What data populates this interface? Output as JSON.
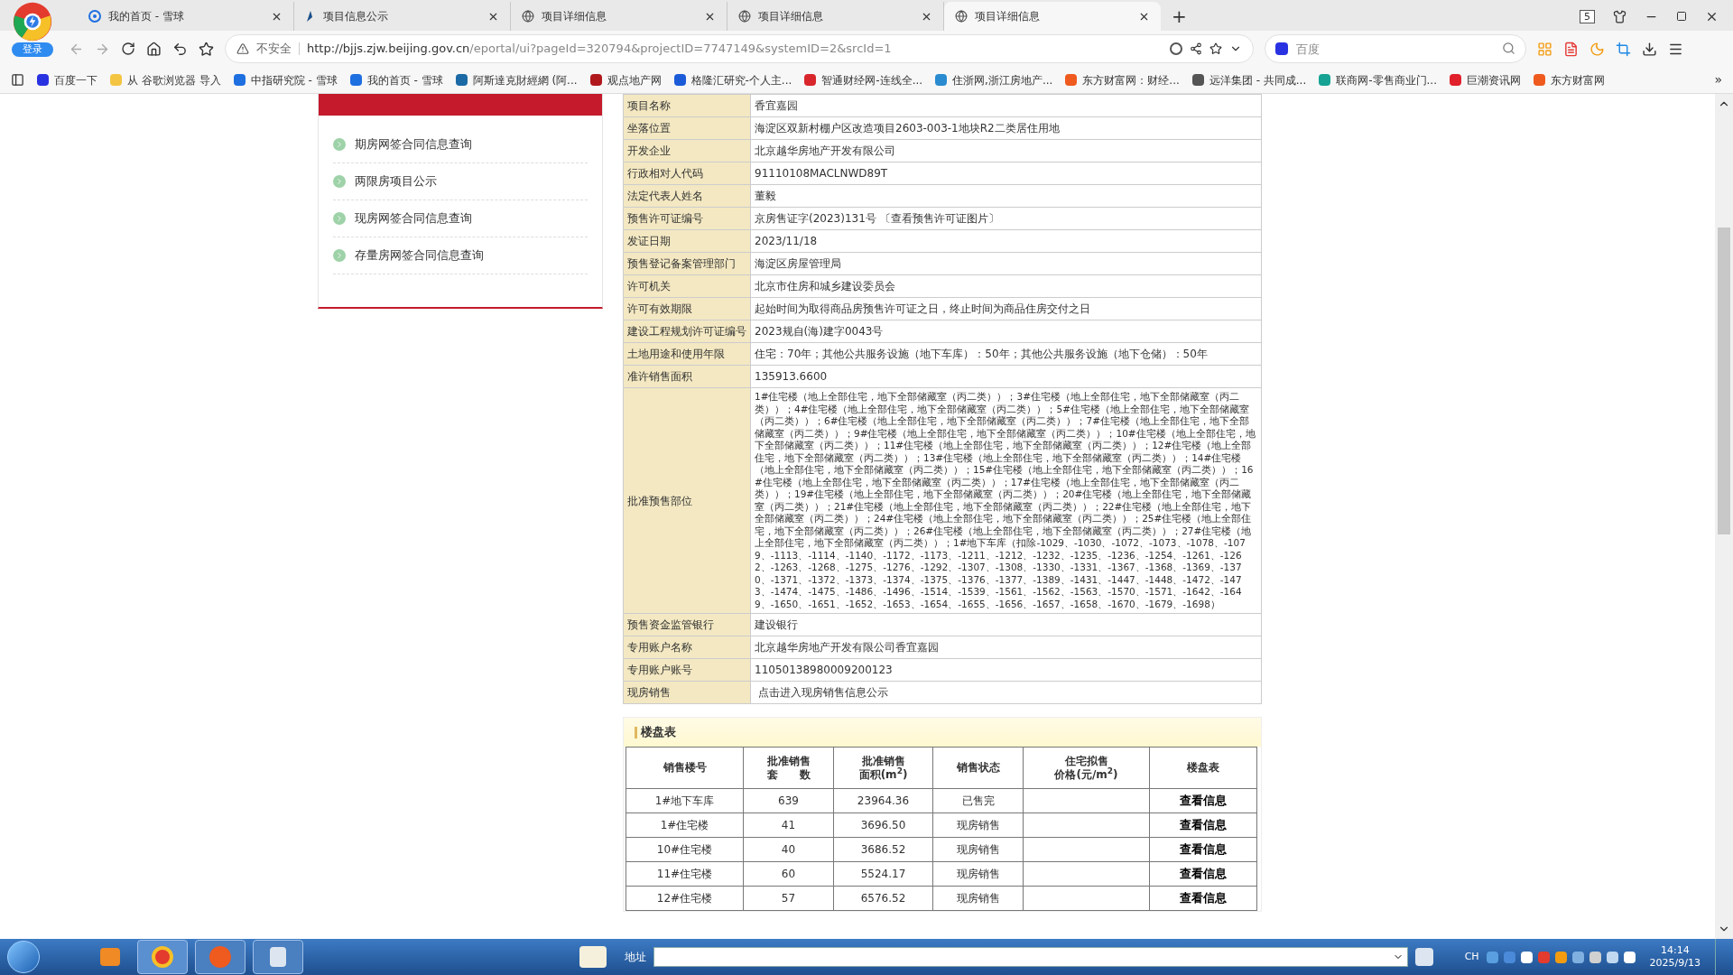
{
  "browser": {
    "login": "登录",
    "tabs": [
      {
        "title": "我的首页 - 雪球",
        "kind": "swirl",
        "selected": false
      },
      {
        "title": "项目信息公示",
        "kind": "feather",
        "selected": false
      },
      {
        "title": "项目详细信息",
        "kind": "globe",
        "selected": false
      },
      {
        "title": "项目详细信息",
        "kind": "globe",
        "selected": false
      },
      {
        "title": "项目详细信息",
        "kind": "globe",
        "selected": true
      }
    ],
    "new_tab": "+",
    "tab_count": "5",
    "address": {
      "security": "不安全",
      "url_host": "http://bjjs.zjw.beijing.gov.cn",
      "url_path": "/eportal/ui?pageId=320794&projectID=7747149&systemID=2&srcId=1"
    },
    "search": {
      "placeholder": "百度"
    },
    "bookmarks": [
      {
        "title": "百度一下",
        "color": "#2932e1"
      },
      {
        "title": "从 谷歌浏览器 导入",
        "color": "#f4c542"
      },
      {
        "title": "中指研究院 - 雪球",
        "color": "#1e6fe0"
      },
      {
        "title": "我的首页 - 雪球",
        "color": "#1e6fe0"
      },
      {
        "title": "阿斯達克財經網 (阿...",
        "color": "#1b6aa5"
      },
      {
        "title": "观点地产网",
        "color": "#b0181c"
      },
      {
        "title": "格隆汇研究-个人主...",
        "color": "#1c5bd8"
      },
      {
        "title": "智通财经网-连线全...",
        "color": "#d8262c"
      },
      {
        "title": "住浙网,浙江房地产...",
        "color": "#2a8bd0"
      },
      {
        "title": "东方财富网：财经...",
        "color": "#ef5a1f"
      },
      {
        "title": "远洋集团 - 共同成...",
        "color": "#555555"
      },
      {
        "title": "联商网-零售商业门...",
        "color": "#16a394"
      },
      {
        "title": "巨潮资讯网",
        "color": "#e0202a"
      },
      {
        "title": "东方财富网",
        "color": "#ef5a1f"
      }
    ],
    "more_bookmarks": "»"
  },
  "sidebar": {
    "items": [
      "期房网签合同信息查询",
      "两限房项目公示",
      "现房网签合同信息查询",
      "存量房网签合同信息查询"
    ]
  },
  "info_table": {
    "rows": [
      {
        "label": "项目名称",
        "value": "香宜嘉园"
      },
      {
        "label": "坐落位置",
        "value": "海淀区双新村棚户区改造项目2603-003-1地块R2二类居住用地"
      },
      {
        "label": "开发企业",
        "value": "北京越华房地产开发有限公司"
      },
      {
        "label": "行政相对人代码",
        "value": "91110108MACLNWD89T"
      },
      {
        "label": "法定代表人姓名",
        "value": "董毅"
      },
      {
        "label": "预售许可证编号",
        "value": "京房售证字(2023)131号",
        "link": "〔查看预售许可证图片〕"
      },
      {
        "label": "发证日期",
        "value": "2023/11/18"
      },
      {
        "label": "预售登记备案管理部门",
        "value": "海淀区房屋管理局"
      },
      {
        "label": "许可机关",
        "value": "北京市住房和城乡建设委员会"
      },
      {
        "label": "许可有效期限",
        "value": "起始时间为取得商品房预售许可证之日，终止时间为商品住房交付之日"
      },
      {
        "label": "建设工程规划许可证编号",
        "value": "2023规自(海)建字0043号"
      },
      {
        "label": "土地用途和使用年限",
        "value": "住宅：70年；其他公共服务设施（地下车库）：50年；其他公共服务设施（地下仓储）：50年"
      },
      {
        "label": "准许销售面积",
        "value": "135913.6600"
      },
      {
        "label": "批准预售部位",
        "value": "1#住宅楼（地上全部住宅，地下全部储藏室（丙二类））；3#住宅楼（地上全部住宅，地下全部储藏室（丙二类））；4#住宅楼（地上全部住宅，地下全部储藏室（丙二类））；5#住宅楼（地上全部住宅，地下全部储藏室（丙二类））；6#住宅楼（地上全部住宅，地下全部储藏室（丙二类））；7#住宅楼（地上全部住宅，地下全部储藏室（丙二类））；9#住宅楼（地上全部住宅，地下全部储藏室（丙二类））；10#住宅楼（地上全部住宅，地下全部储藏室（丙二类））；11#住宅楼（地上全部住宅，地下全部储藏室（丙二类））；12#住宅楼（地上全部住宅，地下全部储藏室（丙二类））；13#住宅楼（地上全部住宅，地下全部储藏室（丙二类））；14#住宅楼（地上全部住宅，地下全部储藏室（丙二类））；15#住宅楼（地上全部住宅，地下全部储藏室（丙二类））；16#住宅楼（地上全部住宅，地下全部储藏室（丙二类））；17#住宅楼（地上全部住宅，地下全部储藏室（丙二类））；19#住宅楼（地上全部住宅，地下全部储藏室（丙二类））；20#住宅楼（地上全部住宅，地下全部储藏室（丙二类））；21#住宅楼（地上全部住宅，地下全部储藏室（丙二类））；22#住宅楼（地上全部住宅，地下全部储藏室（丙二类））；24#住宅楼（地上全部住宅，地下全部储藏室（丙二类））；25#住宅楼（地上全部住宅，地下全部储藏室（丙二类））；26#住宅楼（地上全部住宅，地下全部储藏室（丙二类））；27#住宅楼（地上全部住宅，地下全部储藏室（丙二类））；1#地下车库（扣除-1029、-1030、-1072、-1073、-1078、-1079、-1113、-1114、-1140、-1172、-1173、-1211、-1212、-1232、-1235、-1236、-1254、-1261、-1262、-1263、-1268、-1275、-1276、-1292、-1307、-1308、-1330、-1331、-1367、-1368、-1369、-1370、-1371、-1372、-1373、-1374、-1375、-1376、-1377、-1389、-1431、-1447、-1448、-1472、-1473、-1474、-1475、-1486、-1496、-1514、-1539、-1561、-1562、-1563、-1570、-1571、-1642、-1649、-1650、-1651、-1652、-1653、-1654、-1655、-1656、-1657、-1658、-1670、-1679、-1698）"
      },
      {
        "label": "预售资金监管银行",
        "value": "建设银行"
      },
      {
        "label": "专用账户名称",
        "value": "北京越华房地产开发有限公司香宜嘉园"
      },
      {
        "label": "专用账户账号",
        "value": "11050138980009200123"
      },
      {
        "label": "现房销售",
        "link": "点击进入现房销售信息公示"
      }
    ]
  },
  "buildings": {
    "title": "楼盘表",
    "columns": [
      {
        "lines": [
          "销售楼号"
        ]
      },
      {
        "lines": [
          "批准销售",
          "套　　数"
        ]
      },
      {
        "lines": [
          "批准销售",
          "面积(m$^{2}$)"
        ]
      },
      {
        "lines": [
          "销售状态"
        ]
      },
      {
        "lines": [
          "住宅拟售",
          "价格(元/m$^{2}$)"
        ]
      },
      {
        "lines": [
          "楼盘表"
        ]
      }
    ],
    "rows": [
      {
        "name": "1#地下车库",
        "units": "639",
        "area": "23964.36",
        "status": "已售完",
        "action": "查看信息"
      },
      {
        "name": "1#住宅楼",
        "units": "41",
        "area": "3696.50",
        "status": "现房销售",
        "action": "查看信息"
      },
      {
        "name": "10#住宅楼",
        "units": "40",
        "area": "3686.52",
        "status": "现房销售",
        "action": "查看信息"
      },
      {
        "name": "11#住宅楼",
        "units": "60",
        "area": "5524.17",
        "status": "现房销售",
        "action": "查看信息"
      },
      {
        "name": "12#住宅楼",
        "units": "57",
        "area": "6576.52",
        "status": "现房销售",
        "action": "查看信息"
      }
    ]
  },
  "taskbar": {
    "address_label": "地址",
    "language": "CH",
    "time": "14:14",
    "date": "2025/9/13"
  }
}
